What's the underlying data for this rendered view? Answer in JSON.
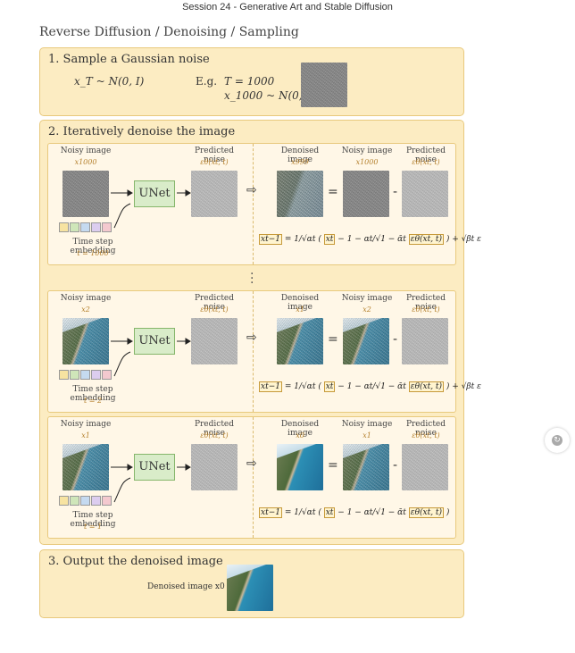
{
  "page": {
    "top_title": "Session 24 - Generative Art and Stable Diffusion",
    "heading": "Reverse Diffusion / Denoising / Sampling"
  },
  "step1": {
    "title": "1. Sample a Gaussian noise",
    "formula_left": "x_T ~ N(0, I)",
    "eg_label": "E.g.",
    "eg_line1": "T = 1000",
    "eg_line2": "x_1000 ~ N(0, I)"
  },
  "step2": {
    "title": "2. Iteratively denoise the image",
    "labels": {
      "noisy_image": "Noisy image",
      "predicted_noise": "Predicted noise",
      "denoised_image": "Denoised image",
      "unet": "UNet",
      "time_step_embedding": "Time step embedding",
      "eps": "εθ(xt, t)"
    },
    "rows": [
      {
        "noisy_sym": "x1000",
        "denoised_sym": "x999",
        "t_label": "t = 1000",
        "formula_tail": "+ √βt ε"
      },
      {
        "noisy_sym": "x2",
        "denoised_sym": "x1",
        "t_label": "t = 2",
        "formula_tail": "+ √βt ε"
      },
      {
        "noisy_sym": "x1",
        "denoised_sym": "x0",
        "t_label": "t = 1",
        "formula_tail": ""
      }
    ],
    "formula": {
      "lhs": "xt−1",
      "eq": "=",
      "frac1_num": "1",
      "frac1_den": "√αt",
      "xt": "xt",
      "minus": "−",
      "frac2_num": "1 − αt",
      "frac2_den": "√1 − ᾱt",
      "eps": "εθ(xt, t)"
    },
    "ops": {
      "equals": "=",
      "minus": "-"
    },
    "ellipsis": "⋮"
  },
  "step3": {
    "title": "3. Output the denoised image",
    "label": "Denoised image x0"
  },
  "colors": {
    "panel_bg": "#fcecc2",
    "panel_border": "#e8c97d",
    "unet_bg": "#d9ecc9",
    "embedding": [
      "#f7e3a1",
      "#cfe6b9",
      "#c5daf0",
      "#dccdef",
      "#f4c9cf"
    ]
  },
  "icons": {
    "arrow": "hollow-right-arrow-icon",
    "side": "bookmark-icon"
  }
}
